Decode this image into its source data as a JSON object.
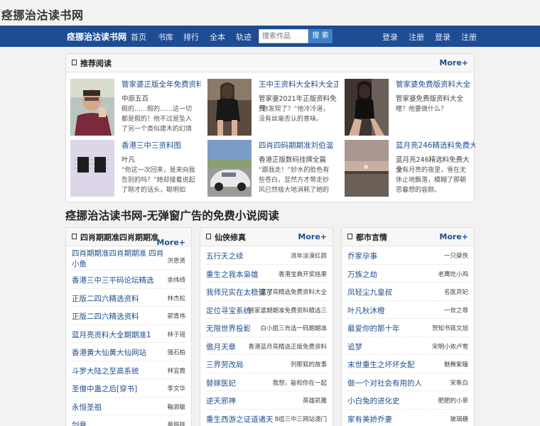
{
  "site": {
    "logo": "痉挪治沽读书网",
    "nav_brand": "痉挪治沽读书网",
    "nav": [
      "首页",
      "书库",
      "排行",
      "全本",
      "轨迹"
    ],
    "search_placeholder": "搜索作品",
    "search_button": "搜 索",
    "account": [
      "登录",
      "注册",
      "登录",
      "注册"
    ]
  },
  "recommend": {
    "title": "推荐阅读",
    "more": "More+",
    "items": [
      {
        "title": "管家婆正版全年免费资料",
        "author": "中原五百",
        "desc": "假的……假的……这一切都是假的！他不过是坠入了另一个类似建木的幻境里！",
        "thumb": "photo-man"
      },
      {
        "title": "王中王资料大全料大全正",
        "author": "管家婆2021年正版资料免费",
        "desc": "“你发现了？”他冷冷道，没有丝毫否认的意味。",
        "thumb": "photo-woman-dark"
      },
      {
        "title": "管家婆免费版资料大全",
        "author": "管家婆免费版资料大全",
        "desc": "瞳？他要做什么？",
        "thumb": "photo-woman-room"
      },
      {
        "title": "香港三中三资料图",
        "author": "叶凡",
        "desc": "“你这一次回来，是来向我告别的吗？”她却接着说起了刚才的话头，聪明如她，显然是早已",
        "thumb": "photo-chips"
      },
      {
        "title": "四肖四码期期准刘伯温",
        "author": "香港正版数码挂牌全篇",
        "desc": "“跟我走！”妙水的脸色有些苍白，显然方才带走妙风已然极大地消耗了她的体力，却一把",
        "thumb": "photo-car"
      },
      {
        "title": "蓝月亮246精选料免费大",
        "author": "蓝月亮246精选料免费大全",
        "desc": "没有月亮的夜里，雪在无休止地飘落，模糊了那朝思暮想的容颜。",
        "thumb": "photo-lake"
      }
    ]
  },
  "headline": "痉挪治沽读书网-无弹窗广告的免费小说阅读",
  "columns": [
    {
      "title": "四肖期期准四肖期期准 四肖小鱼",
      "more": "More+",
      "rows": [
        {
          "title": "四肖期期准四肖期期准 四肖小鱼",
          "author": "洪思贤"
        },
        {
          "title": "香港三中三平码论坛精选",
          "author": "余纬绮"
        },
        {
          "title": "正版二四六精选资料",
          "author": "林杰松"
        },
        {
          "title": "正版二四六精选资料",
          "author": "郭青伟"
        },
        {
          "title": "蓝月亮资料大全期期准1",
          "author": "林子瑶"
        },
        {
          "title": "香港黄大仙黄大仙网站",
          "author": "强石柏"
        },
        {
          "title": "斗罗大陆之至高系统",
          "author": "林宜霞"
        },
        {
          "title": "圣僧中蛊之后[穿书]",
          "author": "李文华"
        },
        {
          "title": "永恒圣祖",
          "author": "鞠淑敏"
        },
        {
          "title": "剑骨",
          "author": "蔡佩桂"
        }
      ]
    },
    {
      "title": "仙侠修真",
      "more": "More+",
      "rows": [
        {
          "title": "五行天之续",
          "author": "流年淡漠红颜"
        },
        {
          "title": "重生之我本枭雄",
          "author": "香港宝典开奖结果"
        },
        {
          "title": "我师兄实在太稳健了",
          "author": "蓝月亮精选免费资料大全"
        },
        {
          "title": "定位寻宝系统",
          "author": "管家婆期期准免费资料精选三"
        },
        {
          "title": "无限世界投影",
          "author": "白小姐三肖选一码期期准"
        },
        {
          "title": "傲月天章",
          "author": "香港蓝月亮精选正版免费资料"
        },
        {
          "title": "三界劳改局",
          "author": "列那狐的故事"
        },
        {
          "title": "替嫁医妃",
          "author": "我想，能和你在一起"
        },
        {
          "title": "逆天邪神",
          "author": "英雄凯撒"
        },
        {
          "title": "重生西游之证道诸天",
          "author": "8组三中三网站澳门"
        }
      ]
    },
    {
      "title": "都市言情",
      "more": "More+",
      "rows": [
        {
          "title": "乔家孕事",
          "author": "一只桀佚"
        },
        {
          "title": "万族之劫",
          "author": "老鹰吃小鸡"
        },
        {
          "title": "凤轻尘九皇叔",
          "author": "名医弃妃"
        },
        {
          "title": "叶凡秋沐橙",
          "author": "一世之尊"
        },
        {
          "title": "最爱你的那十年",
          "author": "贺知书蒋文旭"
        },
        {
          "title": "追梦",
          "author": "宋明小依卢雪"
        },
        {
          "title": "末世重生之坏坏女配",
          "author": "魅舞紫瞳"
        },
        {
          "title": "做一个对社会有用的人",
          "author": "宋象白"
        },
        {
          "title": "小白兔的进化史",
          "author": "肥肥的小草"
        },
        {
          "title": "家有美娇乔妻",
          "author": "玻璃糖"
        }
      ]
    }
  ]
}
